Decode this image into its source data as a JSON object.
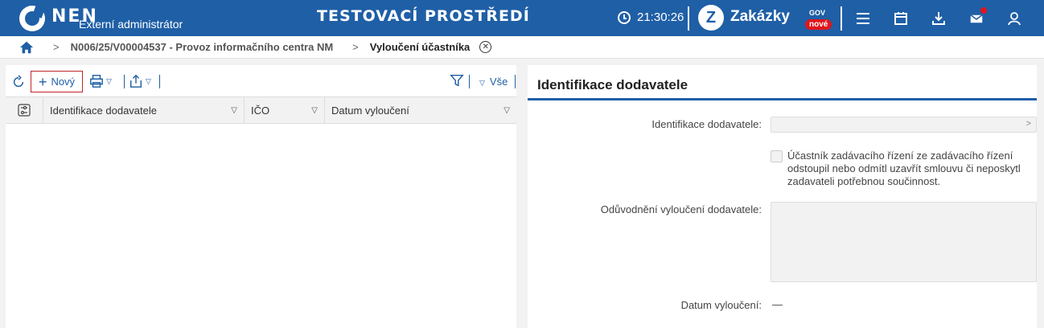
{
  "header": {
    "logo_text": "NEN",
    "logo_sub": "Externí administrátor",
    "env_title": "TESTOVACÍ PROSTŘEDÍ",
    "clock": "21:30:26",
    "zakazky_name": "Zakázky",
    "zakazky_gov": "GOV",
    "zakazky_badge": "nové",
    "brand_color": "#1f5fa6",
    "badge_color": "#e0151b"
  },
  "breadcrumb": {
    "items": [
      {
        "label": "N006/25/V00004537 - Provoz informačního centra NM"
      },
      {
        "label": "Vyloučení účastníka"
      }
    ]
  },
  "toolbar": {
    "new_label": "Nový",
    "all_label": "Vše"
  },
  "grid": {
    "columns": [
      {
        "label": "Identifikace dodavatele"
      },
      {
        "label": "IČO"
      },
      {
        "label": "Datum vyloučení"
      }
    ],
    "rows": []
  },
  "detail": {
    "title": "Identifikace dodavatele",
    "supplier_label": "Identifikace dodavatele:",
    "supplier_value": "",
    "checkbox_text": "Účastník zadávacího řízení ze zadávacího řízení odstoupil nebo odmítl uzavřít smlouvu či neposkytl zadavateli potřebnou součinnost.",
    "checkbox_checked": false,
    "reason_label": "Odůvodnění vyloučení dodavatele:",
    "reason_value": "",
    "date_label": "Datum vyloučení:",
    "date_value": "—"
  }
}
